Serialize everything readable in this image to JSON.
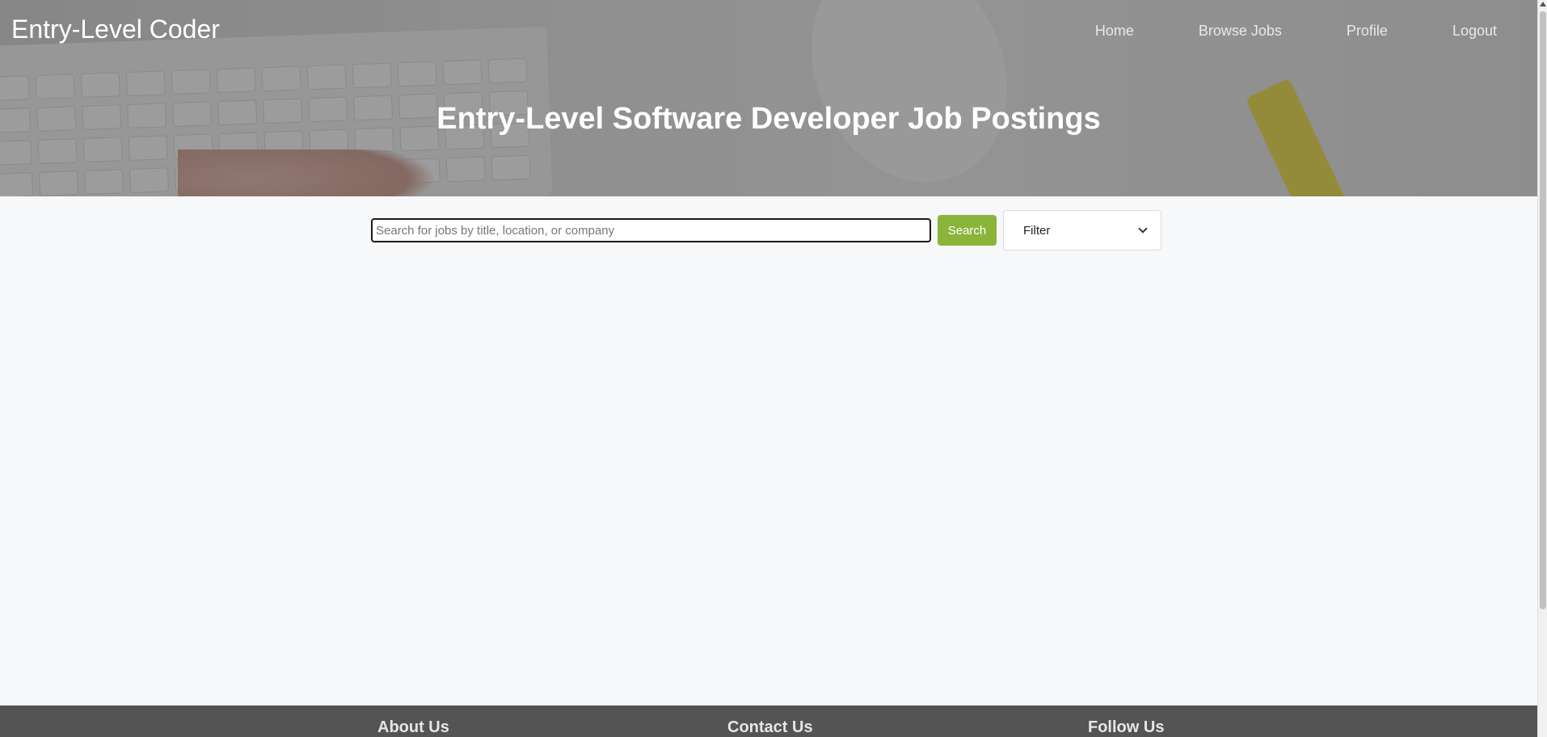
{
  "header": {
    "brand": "Entry-Level Coder",
    "nav": [
      {
        "label": "Home"
      },
      {
        "label": "Browse Jobs"
      },
      {
        "label": "Profile"
      },
      {
        "label": "Logout"
      }
    ],
    "title": "Entry-Level Software Developer Job Postings"
  },
  "search": {
    "placeholder": "Search for jobs by title, location, or company",
    "value": "",
    "button_label": "Search",
    "filter_label": "Filter",
    "filter_icon": "chevron-down-icon"
  },
  "footer": {
    "columns": [
      {
        "label": "About Us"
      },
      {
        "label": "Contact Us"
      },
      {
        "label": "Follow Us"
      }
    ],
    "background": "#545454"
  },
  "colors": {
    "accent": "#8ab43a",
    "page_background": "#f7f8fa"
  }
}
